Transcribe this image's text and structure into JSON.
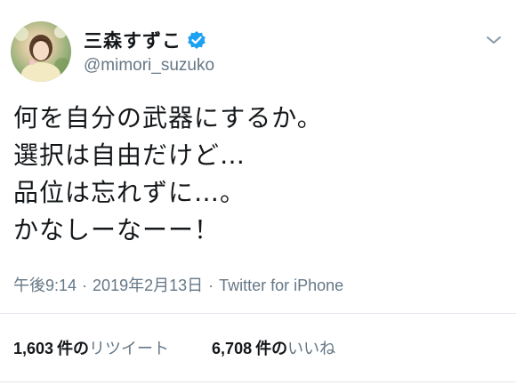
{
  "user": {
    "display_name": "三森すずこ",
    "handle": "@mimori_suzuko",
    "verified": true
  },
  "tweet": {
    "lines": [
      "何を自分の武器にするか。",
      "選択は自由だけど…",
      "品位は忘れずに…。",
      "かなしーなーー！"
    ],
    "time": "午後9:14",
    "date": "2019年2月13日",
    "source": "Twitter for iPhone",
    "separator": "·"
  },
  "stats": {
    "retweets": {
      "count": "1,603",
      "unit": "件の",
      "label": "リツイート"
    },
    "likes": {
      "count": "6,708",
      "unit": "件の",
      "label": "いいね"
    }
  },
  "icons": {
    "verified": "verified-badge-icon",
    "menu": "chevron-down-icon"
  },
  "colors": {
    "text": "#14171a",
    "muted": "#657786",
    "verified": "#1da1f2",
    "divider": "#e1e8ed"
  }
}
